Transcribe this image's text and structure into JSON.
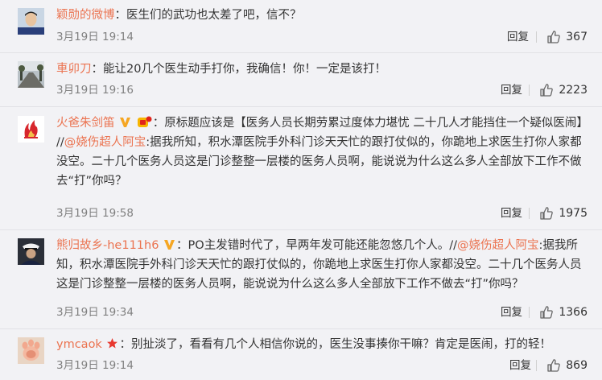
{
  "comments": [
    {
      "user": "颖勋的微博",
      "text": "：医生们的武功也太差了吧，信不？",
      "time": "3月19日 19:14",
      "reply": "回复",
      "likes": "367"
    },
    {
      "user": "車卯刀",
      "text": "：能让20几个医生动手打你，我确信！你！一定是该打！",
      "time": "3月19日 19:16",
      "reply": "回复",
      "likes": "2223"
    },
    {
      "user": "火爸朱剑笛",
      "text_a": "：原标题应该是【医务人员长期劳累过度体力堪忧 二十几人才能挡住一个疑似医闹】 //",
      "mention": "@娆伤超人阿宝",
      "text_b": ":据我所知，积水潭医院手外科门诊天天忙的跟打仗似的，你跪地上求医生打你人家都没空。二十几个医务人员这是门诊整整一层楼的医务人员啊，能说说为什么这么多人全部放下工作不做去“打”你吗？",
      "time": "3月19日 19:58",
      "reply": "回复",
      "likes": "1975"
    },
    {
      "user": "熊归故乡-he111h6",
      "text_a": "：PO主发错时代了，早两年发可能还能忽悠几个人。//",
      "mention": "@娆伤超人阿宝",
      "text_b": ":据我所知，积水潭医院手外科门诊天天忙的跟打仗似的，你跪地上求医生打你人家都没空。二十几个医务人员这是门诊整整一层楼的医务人员啊，能说说为什么这么多人全部放下工作不做去“打”你吗？",
      "time": "3月19日 19:34",
      "reply": "回复",
      "likes": "1366"
    },
    {
      "user": "ymcaok",
      "text": "：别扯淡了，看看有几个人相信你说的，医生没事揍你干嘛？肯定是医闹，打的轻！",
      "time": "3月19日 19:14",
      "reply": "回复",
      "likes": "869"
    }
  ],
  "colors": {
    "accent": "#eb7350",
    "text": "#333333",
    "meta": "#808080",
    "background": "#f2f2f5"
  },
  "icons": [
    "thumbs-up-icon",
    "verified-v-icon",
    "member-badge-icon",
    "star-badge-icon"
  ]
}
